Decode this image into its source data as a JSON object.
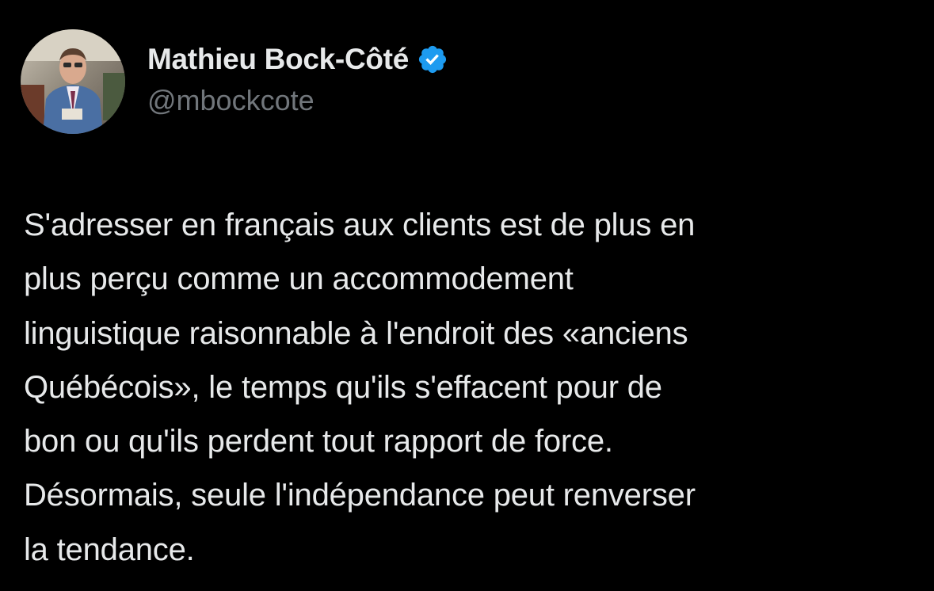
{
  "author": {
    "display_name": "Mathieu Bock-Côté",
    "handle": "@mbockcote",
    "verified": true,
    "verified_color": "#1d9bf0",
    "avatar_icon": "profile-photo"
  },
  "tweet": {
    "lines": [
      "S'adresser en français aux clients est de plus en",
      "plus perçu comme un accommodement",
      "linguistique raisonnable à l'endroit des «anciens",
      "Québécois», le temps qu'ils s'effacent pour de",
      "bon ou qu'ils perdent tout rapport de force.",
      "Désormais, seule l'indépendance peut renverser",
      "la tendance."
    ]
  },
  "colors": {
    "background": "#000000",
    "primary_text": "#e7e9ea",
    "secondary_text": "#71767b"
  }
}
